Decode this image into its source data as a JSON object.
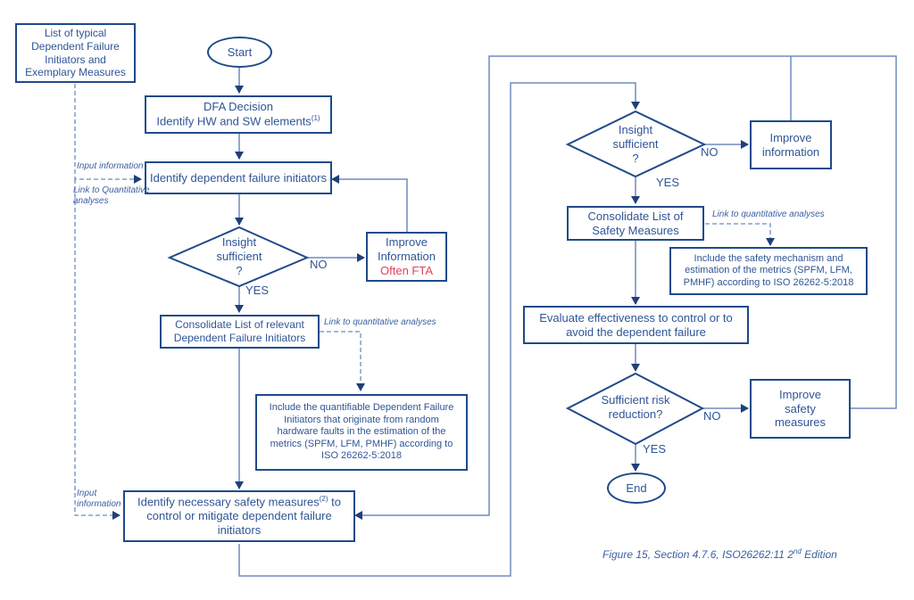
{
  "nodes": {
    "typical_list": "List of typical Dependent Failure Initiators and Exemplary Measures",
    "start": "Start",
    "dfa_decision_line1": "DFA Decision",
    "dfa_decision_line2": "Identify HW and SW elements",
    "dfa_decision_sup": "(1)",
    "identify_initiators": "Identify dependent failure initiators",
    "insight1_line1": "Insight",
    "insight1_line2": "sufficient",
    "insight1_line3": "?",
    "improve_info1_line1": "Improve",
    "improve_info1_line2": "Information",
    "improve_info1_line3": "Often FTA",
    "consolidate_initiators": "Consolidate List of relevant Dependent Failure Initiators",
    "include_quantifiable": "Include the quantifiable Dependent Failure Initiators that originate from random hardware faults in the estimation of the metrics (SPFM, LFM, PMHF) according to ISO 26262-5:2018",
    "identify_measures_pre": "Identify necessary safety measures",
    "identify_measures_sup": "(2)",
    "identify_measures_post": " to control or mitigate dependent failure initiators",
    "insight2_line1": "Insight",
    "insight2_line2": "sufficient",
    "insight2_line3": "?",
    "improve_info2": "Improve information",
    "consolidate_measures": "Consolidate List of Safety Measures",
    "include_mechanism": "Include the safety mechanism and estimation of the metrics (SPFM, LFM, PMHF) according to ISO 26262-5:2018",
    "evaluate": "Evaluate effectiveness to control or to avoid the dependent failure",
    "risk_line1": "Sufficient risk",
    "risk_line2": "reduction?",
    "improve_safety": "Improve safety measures",
    "end": "End"
  },
  "labels": {
    "no": "NO",
    "yes": "YES",
    "input_information": "Input information",
    "link_quant_caps": "Link to Quantitative analyses",
    "link_quant": "Link to quantitative analyses",
    "input": "Input",
    "information": "information"
  },
  "caption": {
    "text": "Figure 15, Section 4.7.6, ISO26262:11 2",
    "sup": "nd",
    "tail": " Edition"
  },
  "colors": {
    "box_border": "#1f4a8a",
    "line": "#6e8cc0",
    "text": "#2f5596",
    "highlight": "#e0405a"
  }
}
